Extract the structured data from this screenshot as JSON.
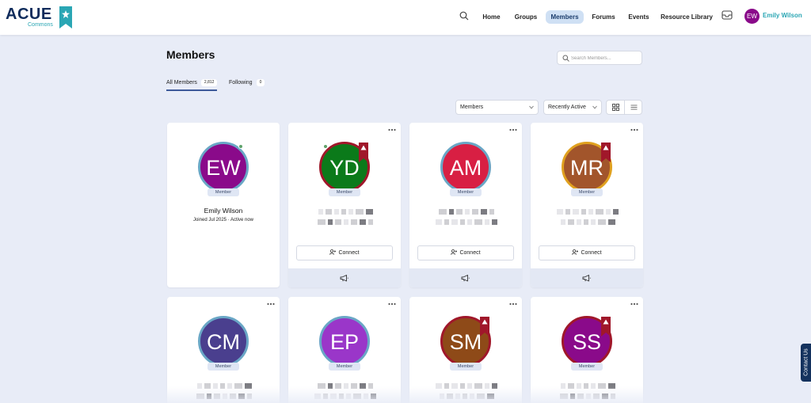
{
  "brand": {
    "name": "ACUE",
    "sub": "Commons",
    "accent": "#2aa6b4",
    "navy": "#0f2c5c"
  },
  "nav": {
    "items": [
      {
        "label": "Home",
        "active": false
      },
      {
        "label": "Groups",
        "active": false
      },
      {
        "label": "Members",
        "active": true
      },
      {
        "label": "Forums",
        "active": false
      },
      {
        "label": "Events",
        "active": false
      },
      {
        "label": "Resource Library",
        "active": false
      }
    ],
    "user": {
      "initials": "EW",
      "name": "Emily Wilson"
    }
  },
  "page": {
    "title": "Members",
    "search_placeholder": "Search Members..."
  },
  "tabs": [
    {
      "label": "All Members",
      "count": "2,812",
      "active": true
    },
    {
      "label": "Following",
      "count": "0",
      "active": false
    }
  ],
  "filters": {
    "type": "Members",
    "order": "Recently Active"
  },
  "badge_label": "Member",
  "connect_label": "Connect",
  "contact_label": "Contact Us",
  "cards": [
    {
      "initials": "EW",
      "color": "#8a0a8a",
      "name": "Emily Wilson",
      "meta": "Joined Jul 2025 · Active now",
      "online": true,
      "ribbon": false,
      "ring": "#6aa7c6"
    },
    {
      "initials": "YD",
      "color": "#0b7a1a",
      "online": true,
      "ribbon": true,
      "ring": "#a0172a"
    },
    {
      "initials": "AM",
      "color": "#d81f43",
      "online": false,
      "ribbon": false,
      "ring": "#6aa7c6"
    },
    {
      "initials": "MR",
      "color": "#a2552b",
      "online": false,
      "ribbon": true,
      "ring": "#e0a11f"
    },
    {
      "initials": "CM",
      "color": "#4a3f8e",
      "online": false,
      "ribbon": false,
      "ring": "#6aa7c6"
    },
    {
      "initials": "EP",
      "color": "#9a36c9",
      "online": false,
      "ribbon": false,
      "ring": "#6aa7c6"
    },
    {
      "initials": "SM",
      "color": "#8e4a18",
      "online": false,
      "ribbon": true,
      "ring": "#a0172a"
    },
    {
      "initials": "SS",
      "color": "#8a0a8a",
      "online": false,
      "ribbon": true,
      "ring": "#a0172a"
    }
  ]
}
